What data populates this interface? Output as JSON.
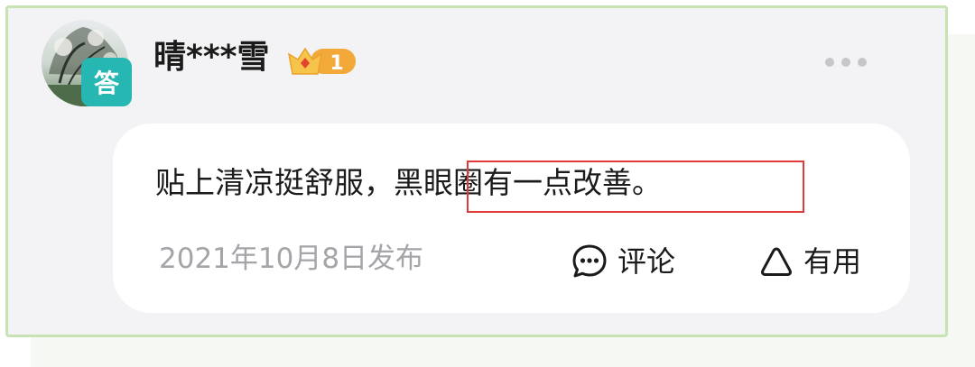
{
  "user": {
    "name": "晴***雪",
    "avatar_badge": "答",
    "level": "1"
  },
  "post": {
    "text_part1": "贴上清凉挺舒服，",
    "text_part2": "黑眼圈有一点改善。",
    "date": "2021年10月8日发布"
  },
  "actions": {
    "comment_label": "评论",
    "useful_label": "有用"
  },
  "icons": {
    "more": "more-dots-icon",
    "comment": "comment-bubble-icon",
    "useful": "triangle-useful-icon",
    "level_crown": "crown-level-icon"
  },
  "colors": {
    "card_border": "#c8e3b3",
    "badge_teal": "#26b7b3",
    "highlight_red": "#e03a3a",
    "crown_gold": "#f2b33a",
    "date_gray": "#a4a4a9"
  }
}
